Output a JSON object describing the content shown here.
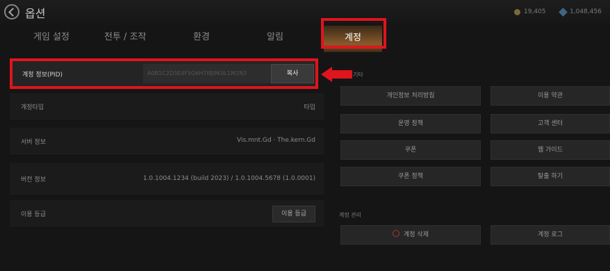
{
  "header": {
    "title": "옵션",
    "right_items": [
      {
        "label": "19,405",
        "icon": "coin-icon"
      },
      {
        "label": "1,048,456",
        "icon": "gem-icon"
      }
    ]
  },
  "tabs": [
    {
      "label": "게임 설정"
    },
    {
      "label": "전투 / 조작"
    },
    {
      "label": "환경"
    },
    {
      "label": "알림"
    },
    {
      "label": "계정",
      "active": true
    }
  ],
  "account": {
    "pid_label": "계정 정보(PID)",
    "pid_value": "A0B1C2D3E4F5G6H7I8J9K0L1M2N3",
    "copy_label": "복사",
    "rows": [
      {
        "label": "계정타입",
        "value": "타입"
      },
      {
        "label": "서버 정보",
        "value": "Vis.mnt.Gd  ·  The.kern.Gd"
      },
      {
        "label": "버전 정보",
        "value": "1.0.1004.1234 (build 2023) / 1.0.1004.5678 (1.0.0001)"
      },
      {
        "label": "이용 등급",
        "button": "이용 등급"
      }
    ]
  },
  "links": {
    "section_label": "기타",
    "left_buttons": [
      "개인정보 처리방침",
      "운영 정책",
      "쿠폰",
      "쿠폰 정책"
    ],
    "right_buttons": [
      "이용 약관",
      "고객 센터",
      "웹 가이드",
      "탈출 하기"
    ]
  },
  "account_mgmt": {
    "section_label": "계정 관리",
    "delete_label": "계정 삭제",
    "logout_label": "계정 로그"
  },
  "colors": {
    "highlight": "#e0141c",
    "active_tab": "#8a5a2a"
  }
}
